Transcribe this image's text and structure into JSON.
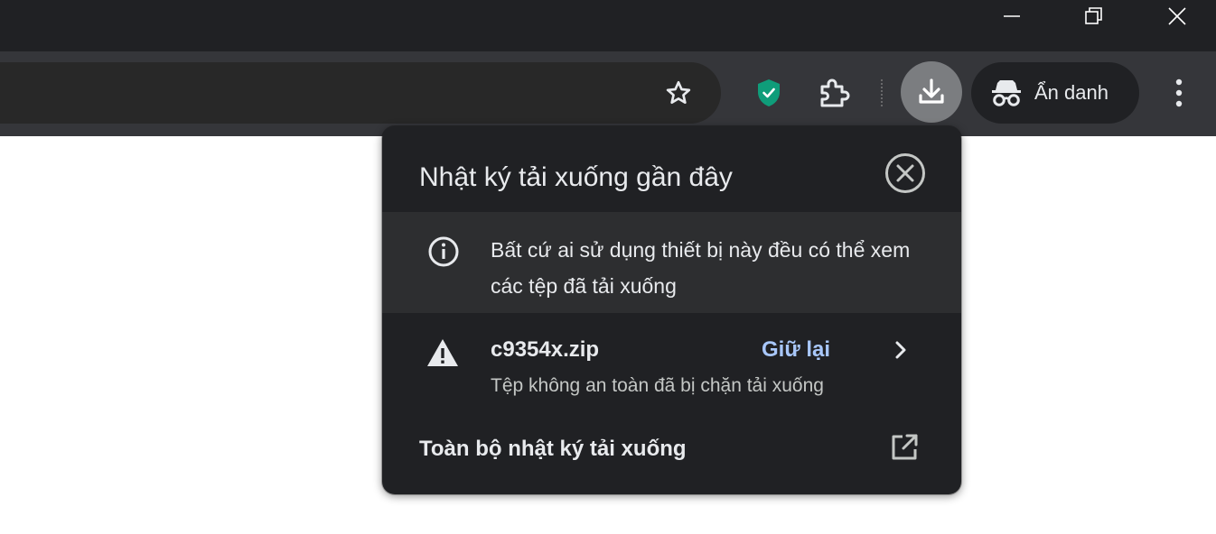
{
  "window_controls": {
    "minimize_icon": "minimize-icon",
    "restore_icon": "restore-icon",
    "close_icon": "close-icon"
  },
  "toolbar": {
    "bookmark_icon": "star-icon",
    "extension_badge_icon": "shield-check-icon",
    "extensions_icon": "puzzle-icon",
    "download_icon": "download-icon",
    "incognito_label": "Ẩn danh",
    "menu_icon": "kebab-menu-icon",
    "accent_color": "#0f9d7a"
  },
  "downloads_bubble": {
    "title": "Nhật ký tải xuống gần đây",
    "close_icon": "close-circle-icon",
    "notice": {
      "icon": "info-icon",
      "text": "Bất cứ ai sử dụng thiết bị này đều có thể xem các tệp đã tải xuống"
    },
    "item": {
      "icon": "warning-icon",
      "filename": "c9354x.zip",
      "action_label": "Giữ lại",
      "status": "Tệp không an toàn đã bị chặn tải xuống",
      "action_color": "#a8c7fa"
    },
    "footer_link": {
      "label": "Toàn bộ nhật ký tải xuống",
      "icon": "open-in-new-icon"
    }
  }
}
